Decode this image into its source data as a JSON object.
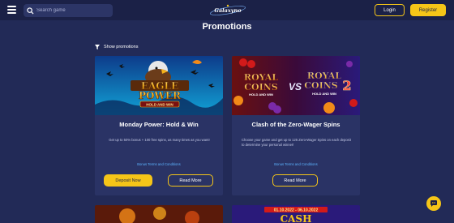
{
  "header": {
    "search_placeholder": "Search game",
    "logo_text": "Galaxyno",
    "login_label": "Login",
    "register_label": "Register"
  },
  "page": {
    "title": "Promotions",
    "filter_label": "Show promotions"
  },
  "cards": [
    {
      "image_text_line1": "EAGLE",
      "image_text_line2": "POWER",
      "image_text_line3": "HOLD AND WIN",
      "title": "Monday Power: Hold & Win",
      "description": "Get up to 50% bonus + 100 free spins, as many times as you want!",
      "terms_label": "Bonus Terms and Conditions",
      "deposit_label": "Deposit Now",
      "read_more_label": "Read More"
    },
    {
      "image_text_left_line1": "ROYAL",
      "image_text_left_line2": "COINS",
      "image_text_left_line3": "HOLD AND WIN",
      "image_text_vs": "VS",
      "image_text_right_line1": "ROYAL",
      "image_text_right_line2": "COINS",
      "image_text_right_number": "2",
      "image_text_right_line3": "HOLD AND WIN",
      "title": "Clash of the Zero-Wager Spins",
      "description": "Choose your game and get up to 125 Zero-Wager Spins on each deposit to determine your personal winner!",
      "terms_label": "Bonus Terms and Conditions",
      "read_more_label": "Read More"
    }
  ],
  "peek_cards": [
    {
      "date_range": "01.10.2022 - 06.10.2022",
      "text": "CASH"
    }
  ],
  "colors": {
    "background": "#222a57",
    "header": "#1b2147",
    "card": "#2a3365",
    "accent": "#f5c518",
    "link": "#5db4ff"
  },
  "icons": [
    "menu-icon",
    "search-icon",
    "filter-icon",
    "chat-icon"
  ]
}
